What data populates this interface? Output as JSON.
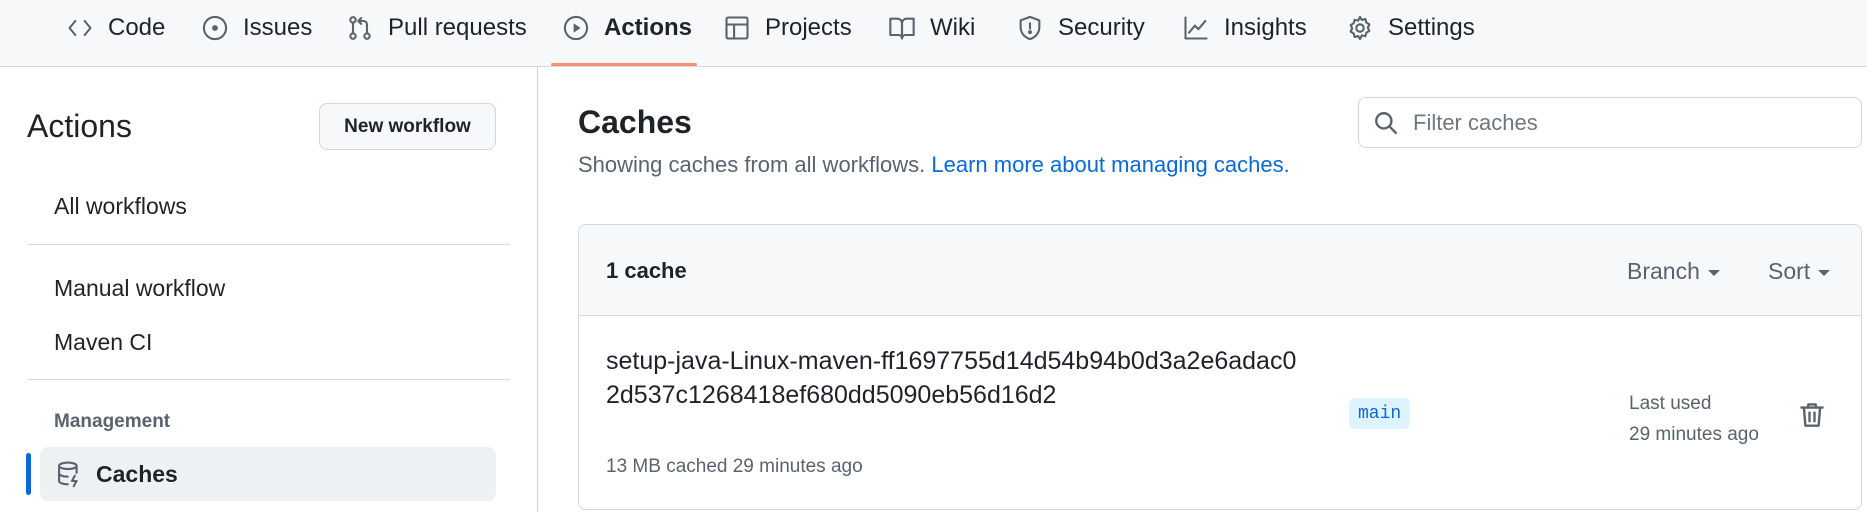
{
  "nav": {
    "tabs": [
      {
        "label": "Code",
        "icon": "code-icon"
      },
      {
        "label": "Issues",
        "icon": "issue-opened-icon"
      },
      {
        "label": "Pull requests",
        "icon": "git-pull-request-icon"
      },
      {
        "label": "Actions",
        "icon": "play-icon",
        "active": true
      },
      {
        "label": "Projects",
        "icon": "table-icon"
      },
      {
        "label": "Wiki",
        "icon": "book-icon"
      },
      {
        "label": "Security",
        "icon": "shield-icon"
      },
      {
        "label": "Insights",
        "icon": "graph-icon"
      },
      {
        "label": "Settings",
        "icon": "gear-icon"
      }
    ],
    "active_underline_color": "#fd8c73"
  },
  "sidebar": {
    "title": "Actions",
    "new_workflow_label": "New workflow",
    "items": [
      {
        "label": "All workflows"
      },
      {
        "label": "Manual workflow"
      },
      {
        "label": "Maven CI"
      }
    ],
    "section_label": "Management",
    "active_item": {
      "label": "Caches",
      "icon": "database-icon"
    },
    "accent_color": "#0969da"
  },
  "main": {
    "title": "Caches",
    "subtitle": "Showing caches from all workflows.",
    "learn_more_label": "Learn more about managing caches.",
    "filter": {
      "placeholder": "Filter caches",
      "value": ""
    },
    "list": {
      "count_label": "1 cache",
      "branch_filter_label": "Branch",
      "sort_label": "Sort",
      "rows": [
        {
          "key": "setup-java-Linux-maven-ff1697755d14d54b94b0d3a2e6adac02d537c1268418ef680dd5090eb56d16d2",
          "meta": "13 MB cached 29 minutes ago",
          "branch": "main",
          "last_used_label": "Last used",
          "last_used_value": "29 minutes ago"
        }
      ]
    }
  }
}
